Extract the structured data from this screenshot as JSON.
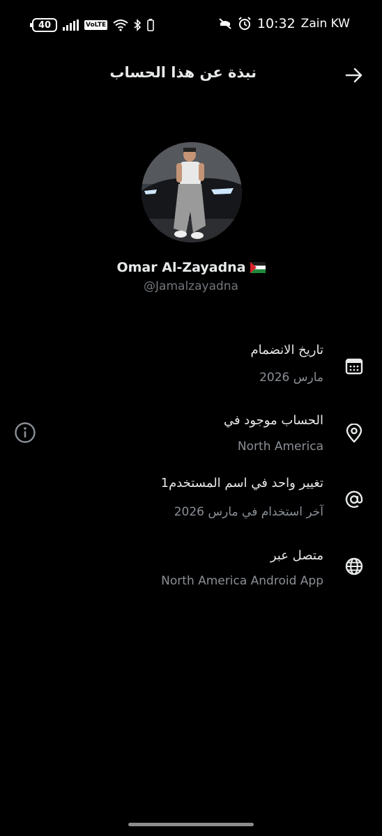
{
  "status_bar": {
    "battery": "40",
    "network": "VoLTE",
    "time": "10:32",
    "carrier": "Zain KW"
  },
  "header": {
    "title": "نبذة عن هذا الحساب",
    "back_icon": "arrow-right-icon"
  },
  "profile": {
    "display_name": "Omar Al-Zayadna",
    "flag": "palestine-flag",
    "handle": "@Jamalzayadna"
  },
  "details": [
    {
      "label": "تاريخ الانضمام",
      "value": "مارس 2026",
      "icon": "calendar-icon"
    },
    {
      "label": "الحساب موجود في",
      "value": "North America",
      "icon": "location-pin-icon"
    },
    {
      "label": "تغيير واحد في اسم المستخدم1",
      "value": "آخر استخدام في مارس 2026",
      "icon": "at-sign-icon"
    },
    {
      "label": "متصل عبر",
      "value": "North America Android App",
      "icon": "globe-icon"
    }
  ],
  "info_icon": "info-icon",
  "colors": {
    "background": "#000000",
    "primary_text": "#e7e9ea",
    "secondary_text": "#71767b"
  }
}
